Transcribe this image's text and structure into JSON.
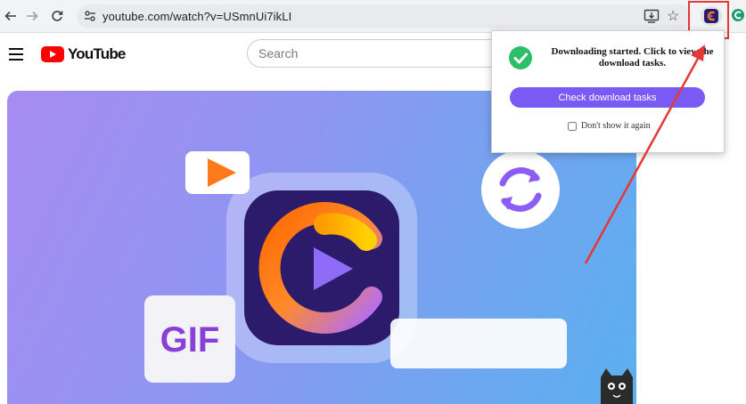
{
  "browser": {
    "url": "youtube.com/watch?v=USmnUi7ikLI",
    "back_icon": "arrow-left-icon",
    "forward_icon": "arrow-right-icon",
    "reload_icon": "reload-icon",
    "star_icon": "star-icon"
  },
  "youtube": {
    "logo_text": "YouTube",
    "search_placeholder": "Search"
  },
  "video": {
    "thumbnail_badge": "GIF"
  },
  "popup": {
    "message": "Downloading started. Click to view the download tasks.",
    "button_label": "Check download tasks",
    "checkbox_label": "Don't show it again",
    "checkbox_checked": false
  },
  "colors": {
    "accent_purple": "#7a5af5",
    "success_green": "#2dbf68",
    "highlight_red": "#e53935",
    "youtube_red": "#ff0000"
  }
}
